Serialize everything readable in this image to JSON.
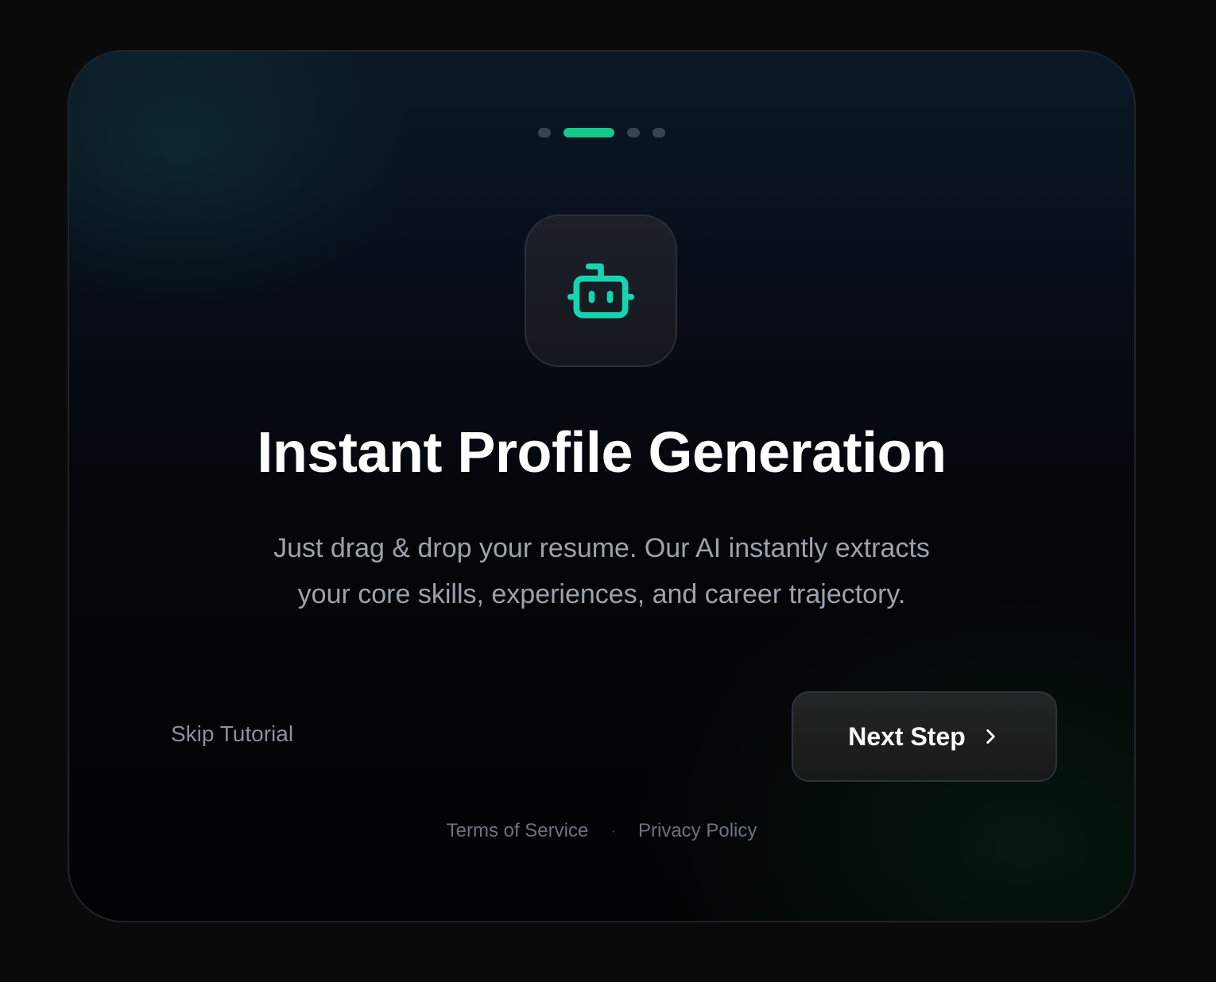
{
  "pagination": {
    "total": 4,
    "active_index": 1
  },
  "icon": {
    "name": "robot-icon",
    "color": "#16d4b0"
  },
  "content": {
    "title": "Instant Profile Generation",
    "description": "Just drag & drop your resume. Our AI instantly extracts your core skills, experiences, and career trajectory."
  },
  "actions": {
    "skip_label": "Skip Tutorial",
    "next_label": "Next Step",
    "next_icon": "chevron-right-icon"
  },
  "footer": {
    "terms_label": "Terms of Service",
    "separator": "·",
    "privacy_label": "Privacy Policy"
  },
  "colors": {
    "accent": "#16c98a",
    "inactive_dot": "#3b4350",
    "background": "#0a0a0a"
  }
}
